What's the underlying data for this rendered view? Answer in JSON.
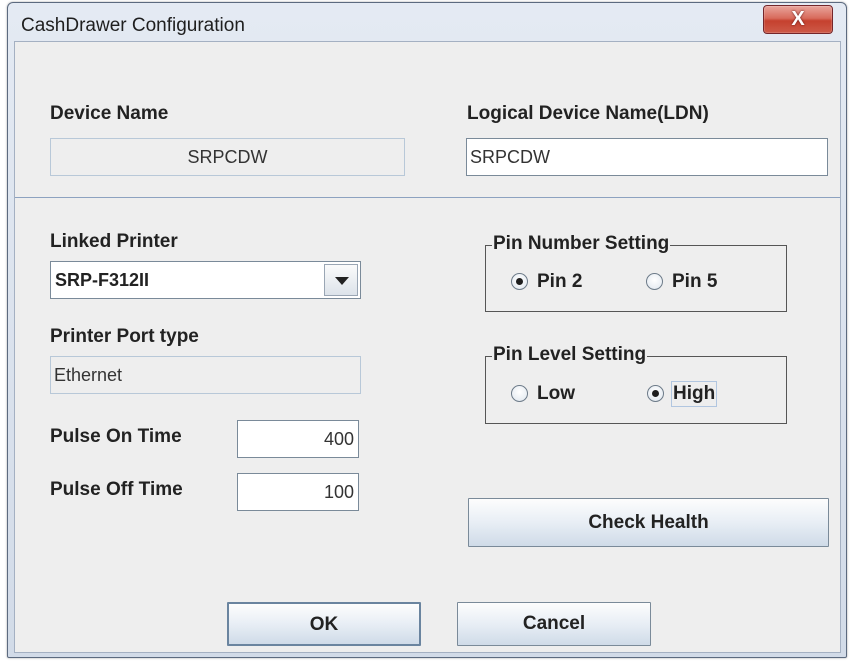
{
  "window": {
    "title": "CashDrawer Configuration",
    "close_glyph": "X"
  },
  "device": {
    "name_label": "Device Name",
    "name_value": "SRPCDW",
    "ldn_label": "Logical Device Name(LDN)",
    "ldn_value": "SRPCDW"
  },
  "printer": {
    "linked_label": "Linked Printer",
    "linked_value": "SRP-F312II",
    "port_label": "Printer Port type",
    "port_value": "Ethernet"
  },
  "pulse": {
    "on_label": "Pulse On Time",
    "on_value": "400",
    "off_label": "Pulse Off Time",
    "off_value": "100"
  },
  "pin_number": {
    "title": "Pin Number Setting",
    "option1": "Pin 2",
    "option2": "Pin 5",
    "selected": "Pin 2"
  },
  "pin_level": {
    "title": "Pin Level Setting",
    "option1": "Low",
    "option2": "High",
    "selected": "High"
  },
  "buttons": {
    "check_health": "Check Health",
    "ok": "OK",
    "cancel": "Cancel"
  },
  "icons": {
    "combo_arrow": "chevron-down-icon",
    "close": "close-icon"
  },
  "colors": {
    "close_button": "#c5412f",
    "panel": "#eeeeee",
    "separator": "#8da2c0"
  }
}
